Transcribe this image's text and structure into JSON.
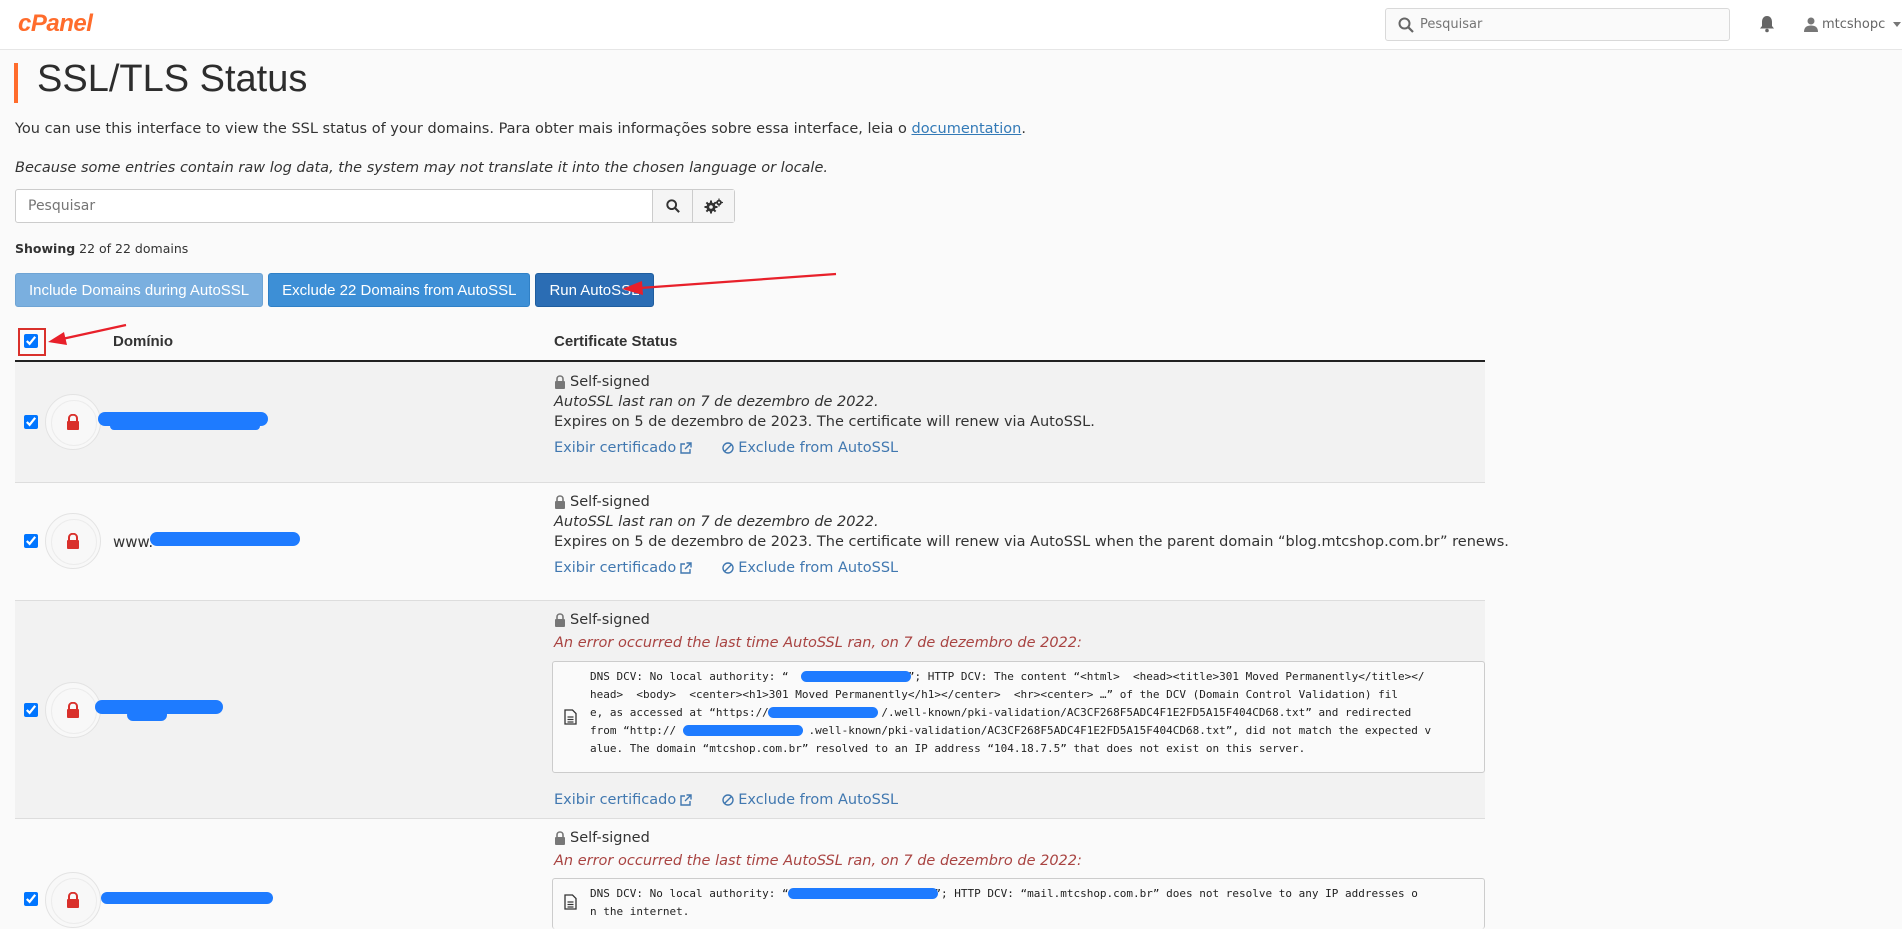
{
  "header": {
    "logo": "cPanel",
    "search_placeholder": "Pesquisar",
    "username": "mtcshopc"
  },
  "page": {
    "title": "SSL/TLS Status",
    "intro_text": "You can use this interface to view the SSL status of your domains. Para obter mais informações sobre essa interface, leia o ",
    "intro_link": "documentation",
    "intro_end": ".",
    "note": "Because some entries contain raw log data, the system may not translate it into the chosen language or locale.",
    "filter_placeholder": "Pesquisar",
    "showing_label": "Showing",
    "showing_count": "22 of 22 domains"
  },
  "actions": {
    "include": "Include Domains during AutoSSL",
    "exclude": "Exclude 22 Domains from AutoSSL",
    "run": "Run AutoSSL"
  },
  "table": {
    "col_domain": "Domínio",
    "col_status": "Certificate Status",
    "rows": [
      {
        "domain": "",
        "status": "Self-signed",
        "line1": "AutoSSL last ran on 7 de dezembro de 2022.",
        "line2": "Expires on 5 de dezembro de 2023. The certificate will renew via AutoSSL.",
        "view_link": "Exibir certificado",
        "exclude_link": "Exclude from AutoSSL"
      },
      {
        "domain": "www.",
        "status": "Self-signed",
        "line1": "AutoSSL last ran on 7 de dezembro de 2022.",
        "line2": "Expires on 5 de dezembro de 2023. The certificate will renew via AutoSSL when the parent domain “blog.mtcshop.com.br” renews.",
        "view_link": "Exibir certificado",
        "exclude_link": "Exclude from AutoSSL"
      },
      {
        "domain": "",
        "status": "Self-signed",
        "error": "An error occurred the last time AutoSSL ran, on 7 de dezembro de 2022:",
        "log": [
          "DNS DCV: No local authority: “                  ”; HTTP DCV: The content “<html>  <head><title>301 Moved Permanently</title></",
          "head>  <body>  <center><h1>301 Moved Permanently</h1></center>  <hr><center> …” of the DCV (Domain Control Validation) fil",
          "e, as accessed at “https://                 /.well-known/pki-validation/AC3CF268F5ADC4F1E2FD5A15F404CD68.txt” and redirected",
          "from “http://                    .well-known/pki-validation/AC3CF268F5ADC4F1E2FD5A15F404CD68.txt”, did not match the expected v",
          "alue. The domain “mtcshop.com.br” resolved to an IP address “104.18.7.5” that does not exist on this server."
        ],
        "view_link": "Exibir certificado",
        "exclude_link": "Exclude from AutoSSL"
      },
      {
        "domain": "",
        "status": "Self-signed",
        "error": "An error occurred the last time AutoSSL ran, on 7 de dezembro de 2022:",
        "log": [
          "DNS DCV: No local authority: “                      ”; HTTP DCV: “mail.mtcshop.com.br” does not resolve to any IP addresses o",
          "n the internet."
        ]
      }
    ]
  },
  "colors": {
    "accent": "#ff6c2c",
    "link": "#4178b0",
    "error": "#a94442",
    "lock": "#d9302b",
    "annotation": "#e8202a"
  }
}
